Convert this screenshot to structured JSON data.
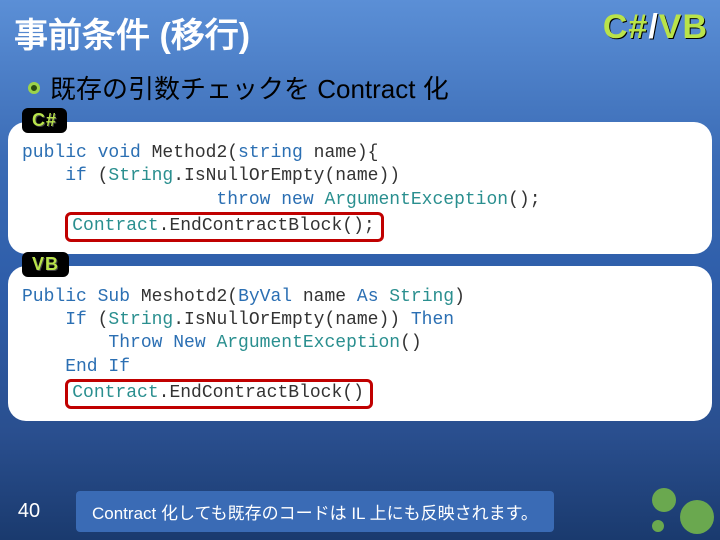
{
  "header": {
    "title": "事前条件 (移行)",
    "lang_csharp": "C#",
    "lang_slash": "/",
    "lang_vb": "VB"
  },
  "bullet": {
    "text": "既存の引数チェックを Contract 化"
  },
  "csharp_block": {
    "tag": "C#",
    "line1_pre": "public void",
    "line1_mid": " Method2(",
    "line1_type": "string",
    "line1_end": " name){",
    "line2_pre": "    if",
    "line2_mid": " (",
    "line2_type": "String",
    "line2_end": ".IsNullOrEmpty(name))",
    "line3_pre": "                  throw new ",
    "line3_type": "ArgumentException",
    "line3_end": "();",
    "line4_pre": "    ",
    "line4_type": "Contract",
    "line4_end": ".EndContractBlock();"
  },
  "vb_block": {
    "tag": "VB",
    "line1_pre": "Public Sub",
    "line1_mid": " Meshotd2(",
    "line1_byv": "ByVal",
    "line1_name": " name ",
    "line1_as": "As ",
    "line1_type": "String",
    "line1_end": ")",
    "line2_pre": "    If",
    "line2_mid": " (",
    "line2_type": "String",
    "line2_call": ".IsNullOrEmpty(name)) ",
    "line2_then": "Then",
    "line3_pre": "        Throw ",
    "line3_new": "New ",
    "line3_type": "ArgumentException",
    "line3_end": "()",
    "line4_pre": "    End If",
    "line5_pre": "    ",
    "line5_type": "Contract",
    "line5_end": ".EndContractBlock()"
  },
  "footer": {
    "page": "40",
    "note": "Contract 化しても既存のコードは IL 上にも反映されます。"
  }
}
